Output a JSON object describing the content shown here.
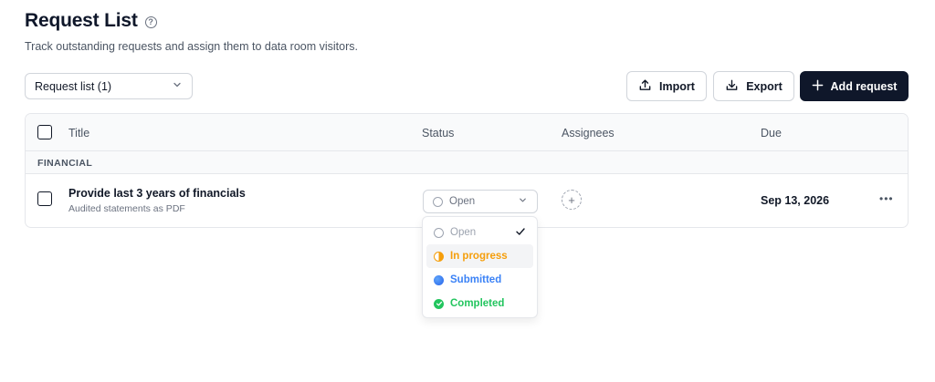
{
  "header": {
    "title": "Request List",
    "subtitle": "Track outstanding requests and assign them to data room visitors."
  },
  "toolbar": {
    "list_select_value": "Request list (1)",
    "import_label": "Import",
    "export_label": "Export",
    "add_label": "Add request"
  },
  "table": {
    "columns": [
      "Title",
      "Status",
      "Assignees",
      "Due"
    ],
    "groups": [
      {
        "label": "FINANCIAL",
        "rows": [
          {
            "title": "Provide last 3 years of financials",
            "subtitle": "Audited statements as PDF",
            "status": "Open",
            "due": "Sep 13, 2026"
          }
        ]
      }
    ]
  },
  "status_dropdown": {
    "options": [
      {
        "label": "Open",
        "color": "#9ca3af",
        "selected": true
      },
      {
        "label": "In progress",
        "color": "#f59e0b"
      },
      {
        "label": "Submitted",
        "color": "#3b82f6"
      },
      {
        "label": "Completed",
        "color": "#22c55e"
      }
    ]
  }
}
